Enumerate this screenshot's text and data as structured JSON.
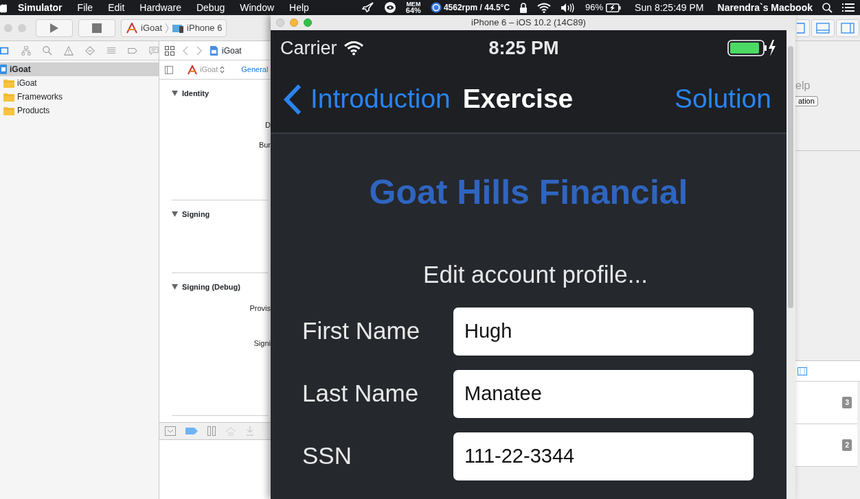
{
  "menu_bar": {
    "app_name": "Simulator",
    "menus": [
      "File",
      "Edit",
      "Hardware",
      "Debug",
      "Window",
      "Help"
    ],
    "mem_label": "MEM",
    "mem_value": "64%",
    "fan_reading": "4562rpm / 44.5°C",
    "battery_percent": "96%",
    "clock": "Sun 8:25:49 PM",
    "user_name": "Narendra`s Macbook"
  },
  "xcode": {
    "toolbar": {
      "scheme": "iGoat",
      "device": "iPhone 6"
    },
    "navigator": {
      "items": [
        {
          "label": "iGoat",
          "kind": "project",
          "selected": true,
          "children": [
            {
              "label": "iGoat",
              "kind": "folder",
              "selected": false
            },
            {
              "label": "Frameworks",
              "kind": "folder",
              "selected": false
            },
            {
              "label": "Products",
              "kind": "folder",
              "selected": false
            }
          ]
        }
      ]
    },
    "editor": {
      "jump_bar": {
        "file": "iGoat"
      },
      "target": "iGoat",
      "tabs": [
        {
          "label": "General",
          "selected": true
        }
      ],
      "sections": [
        {
          "title": "Identity",
          "expanded": true,
          "fields": [
            "D",
            "Bur"
          ]
        },
        {
          "title": "Signing",
          "expanded": true
        },
        {
          "title": "Signing (Debug)",
          "expanded": true,
          "fields": [
            "Provis",
            "Signi"
          ]
        }
      ]
    },
    "inspector": {
      "help_text": "elp",
      "button": "ation",
      "badges": [
        "3",
        "2"
      ]
    }
  },
  "simulator": {
    "title": "iPhone 6 – iOS 10.2 (14C89)",
    "status_bar": {
      "carrier": "Carrier",
      "time": "8:25 PM"
    },
    "nav_bar": {
      "back": "Introduction",
      "title": "Exercise",
      "action": "Solution"
    },
    "heading": "Goat Hills Financial",
    "subheading": "Edit account profile...",
    "fields": [
      {
        "label": "First Name",
        "value": "Hugh"
      },
      {
        "label": "Last Name",
        "value": "Manatee"
      },
      {
        "label": "SSN",
        "value": "111-22-3344"
      }
    ]
  }
}
